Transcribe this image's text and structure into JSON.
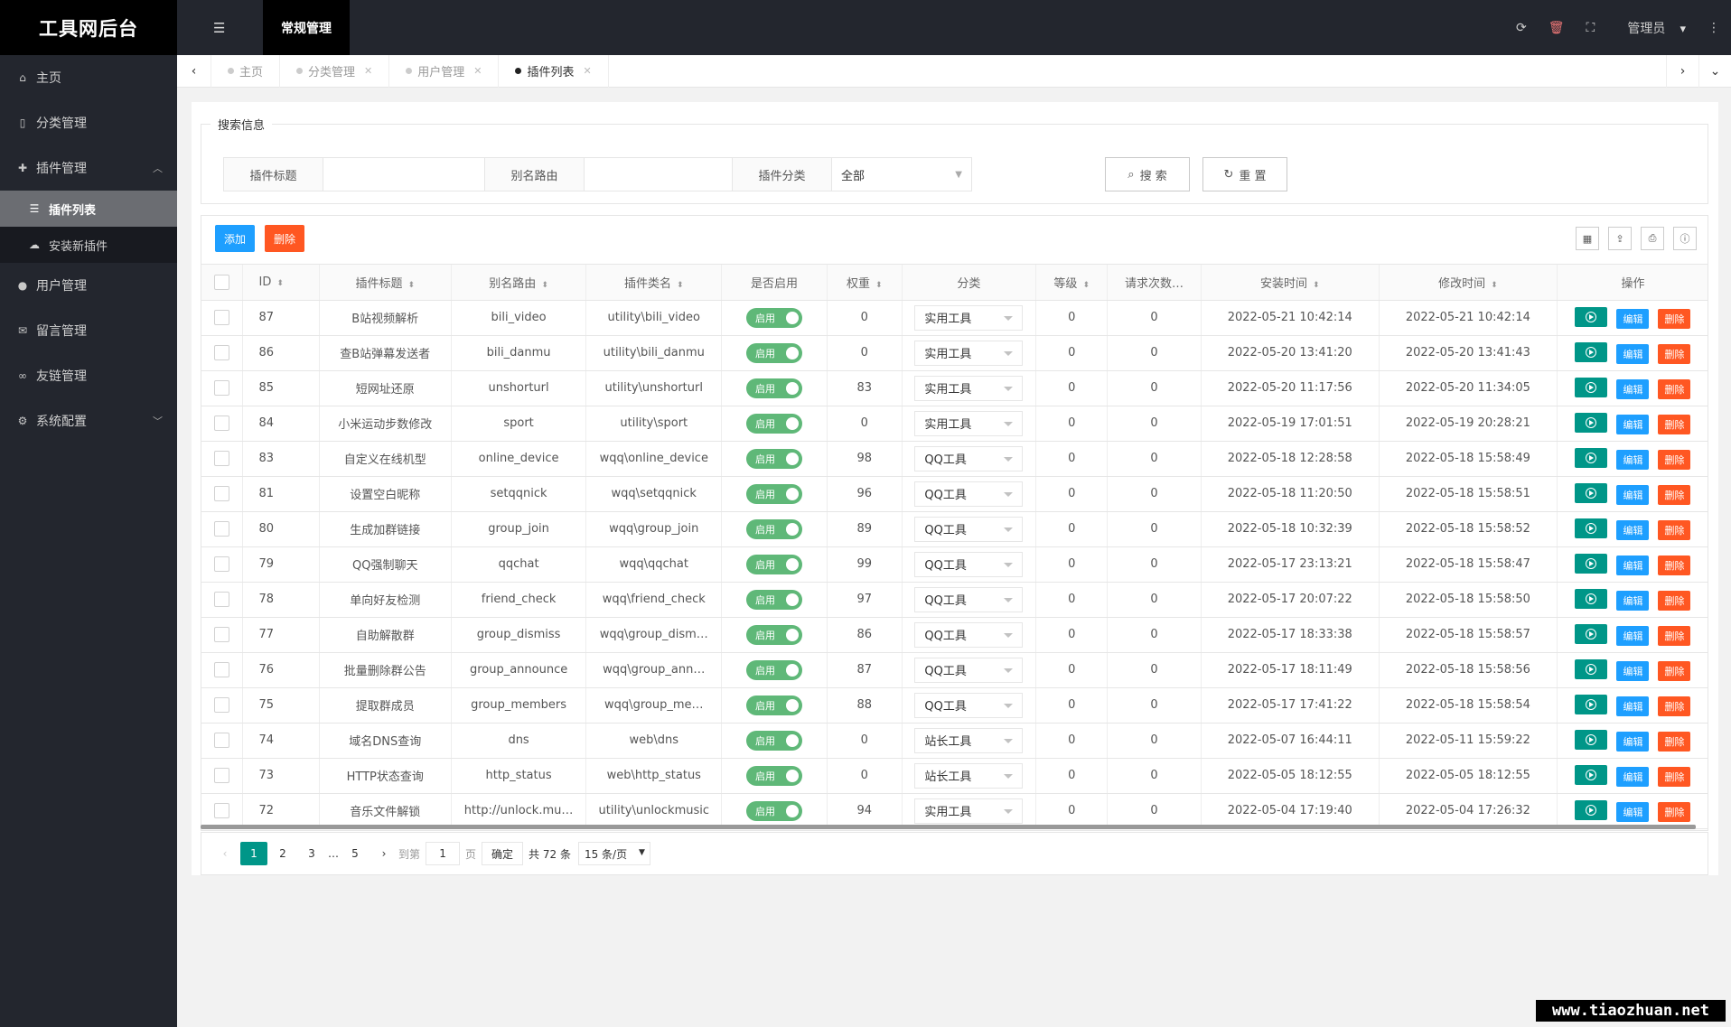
{
  "app": {
    "title": "工具网后台"
  },
  "sidebar": {
    "items": [
      {
        "label": "主页",
        "icon": "home-icon"
      },
      {
        "label": "分类管理",
        "icon": "bookmark-icon"
      },
      {
        "label": "插件管理",
        "icon": "puzzle-icon"
      },
      {
        "label": "用户管理",
        "icon": "user-icon"
      },
      {
        "label": "留言管理",
        "icon": "comments-icon"
      },
      {
        "label": "友链管理",
        "icon": "link-icon"
      },
      {
        "label": "系统配置",
        "icon": "cogs-icon"
      }
    ],
    "sub": [
      {
        "label": "插件列表"
      },
      {
        "label": "安装新插件"
      }
    ]
  },
  "topbar": {
    "module": "常规管理",
    "admin": "管理员"
  },
  "tabs": [
    {
      "label": "主页"
    },
    {
      "label": "分类管理"
    },
    {
      "label": "用户管理"
    },
    {
      "label": "插件列表"
    }
  ],
  "search": {
    "legend": "搜索信息",
    "title_label": "插件标题",
    "alias_label": "别名路由",
    "category_label": "插件分类",
    "category_value": "全部",
    "search_btn": "搜 索",
    "reset_btn": "重 置"
  },
  "toolbar": {
    "add": "添加",
    "delete": "删除"
  },
  "table": {
    "headers": {
      "id": "ID",
      "title": "插件标题",
      "alias": "别名路由",
      "class": "插件类名",
      "enabled": "是否启用",
      "weight": "权重",
      "category": "分类",
      "level": "等级",
      "requests": "请求次数…",
      "install_time": "安装时间",
      "modify_time": "修改时间",
      "ops": "操作"
    },
    "switch_label": "启用",
    "op_edit": "编辑",
    "op_delete": "删除",
    "rows": [
      {
        "id": "87",
        "title": "B站视频解析",
        "alias": "bili_video",
        "class": "utility\\bili_video",
        "weight": "0",
        "category": "实用工具",
        "level": "0",
        "requests": "0",
        "install": "2022-05-21 10:42:14",
        "modify": "2022-05-21 10:42:14"
      },
      {
        "id": "86",
        "title": "查B站弹幕发送者",
        "alias": "bili_danmu",
        "class": "utility\\bili_danmu",
        "weight": "0",
        "category": "实用工具",
        "level": "0",
        "requests": "0",
        "install": "2022-05-20 13:41:20",
        "modify": "2022-05-20 13:41:43"
      },
      {
        "id": "85",
        "title": "短网址还原",
        "alias": "unshorturl",
        "class": "utility\\unshorturl",
        "weight": "83",
        "category": "实用工具",
        "level": "0",
        "requests": "0",
        "install": "2022-05-20 11:17:56",
        "modify": "2022-05-20 11:34:05"
      },
      {
        "id": "84",
        "title": "小米运动步数修改",
        "alias": "sport",
        "class": "utility\\sport",
        "weight": "0",
        "category": "实用工具",
        "level": "0",
        "requests": "0",
        "install": "2022-05-19 17:01:51",
        "modify": "2022-05-19 20:28:21"
      },
      {
        "id": "83",
        "title": "自定义在线机型",
        "alias": "online_device",
        "class": "wqq\\online_device",
        "weight": "98",
        "category": "QQ工具",
        "level": "0",
        "requests": "0",
        "install": "2022-05-18 12:28:58",
        "modify": "2022-05-18 15:58:49"
      },
      {
        "id": "81",
        "title": "设置空白昵称",
        "alias": "setqqnick",
        "class": "wqq\\setqqnick",
        "weight": "96",
        "category": "QQ工具",
        "level": "0",
        "requests": "0",
        "install": "2022-05-18 11:20:50",
        "modify": "2022-05-18 15:58:51"
      },
      {
        "id": "80",
        "title": "生成加群链接",
        "alias": "group_join",
        "class": "wqq\\group_join",
        "weight": "89",
        "category": "QQ工具",
        "level": "0",
        "requests": "0",
        "install": "2022-05-18 10:32:39",
        "modify": "2022-05-18 15:58:52"
      },
      {
        "id": "79",
        "title": "QQ强制聊天",
        "alias": "qqchat",
        "class": "wqq\\qqchat",
        "weight": "99",
        "category": "QQ工具",
        "level": "0",
        "requests": "0",
        "install": "2022-05-17 23:13:21",
        "modify": "2022-05-18 15:58:47"
      },
      {
        "id": "78",
        "title": "单向好友检测",
        "alias": "friend_check",
        "class": "wqq\\friend_check",
        "weight": "97",
        "category": "QQ工具",
        "level": "0",
        "requests": "0",
        "install": "2022-05-17 20:07:22",
        "modify": "2022-05-18 15:58:50"
      },
      {
        "id": "77",
        "title": "自助解散群",
        "alias": "group_dismiss",
        "class": "wqq\\group_dism…",
        "weight": "86",
        "category": "QQ工具",
        "level": "0",
        "requests": "0",
        "install": "2022-05-17 18:33:38",
        "modify": "2022-05-18 15:58:57"
      },
      {
        "id": "76",
        "title": "批量删除群公告",
        "alias": "group_announce",
        "class": "wqq\\group_ann…",
        "weight": "87",
        "category": "QQ工具",
        "level": "0",
        "requests": "0",
        "install": "2022-05-17 18:11:49",
        "modify": "2022-05-18 15:58:56"
      },
      {
        "id": "75",
        "title": "提取群成员",
        "alias": "group_members",
        "class": "wqq\\group_me…",
        "weight": "88",
        "category": "QQ工具",
        "level": "0",
        "requests": "0",
        "install": "2022-05-17 17:41:22",
        "modify": "2022-05-18 15:58:54"
      },
      {
        "id": "74",
        "title": "域名DNS查询",
        "alias": "dns",
        "class": "web\\dns",
        "weight": "0",
        "category": "站长工具",
        "level": "0",
        "requests": "0",
        "install": "2022-05-07 16:44:11",
        "modify": "2022-05-11 15:59:22"
      },
      {
        "id": "73",
        "title": "HTTP状态查询",
        "alias": "http_status",
        "class": "web\\http_status",
        "weight": "0",
        "category": "站长工具",
        "level": "0",
        "requests": "0",
        "install": "2022-05-05 18:12:55",
        "modify": "2022-05-05 18:12:55"
      },
      {
        "id": "72",
        "title": "音乐文件解锁",
        "alias": "http://unlock.mu…",
        "class": "utility\\unlockmusic",
        "weight": "94",
        "category": "实用工具",
        "level": "0",
        "requests": "0",
        "install": "2022-05-04 17:19:40",
        "modify": "2022-05-04 17:26:32"
      }
    ]
  },
  "pager": {
    "pages": [
      "1",
      "2",
      "3",
      "…",
      "5"
    ],
    "goto": "到第",
    "page_input": "1",
    "page_unit": "页",
    "confirm": "确定",
    "total": "共 72 条",
    "limit": "15 条/页"
  },
  "watermark": "www.tiaozhuan.net"
}
